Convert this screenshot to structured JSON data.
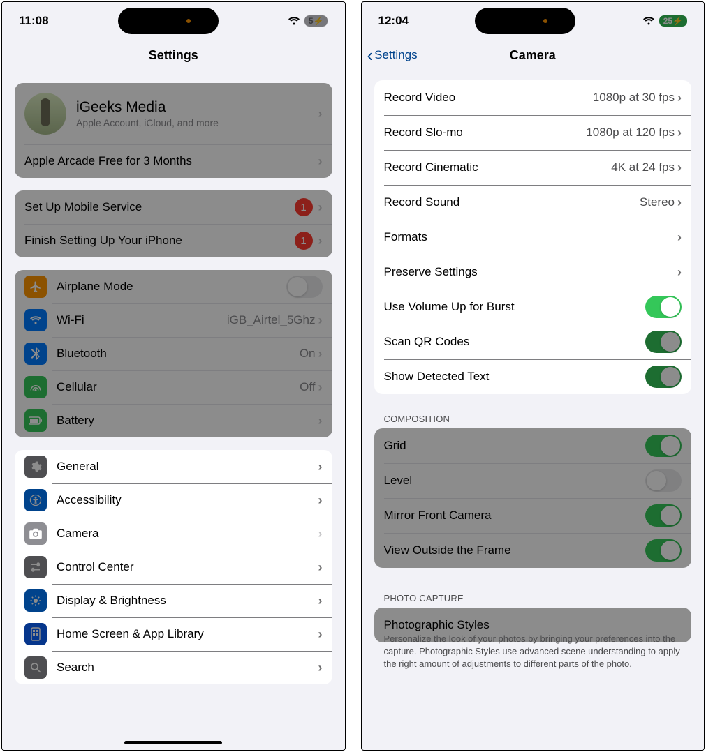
{
  "left": {
    "time": "11:08",
    "battery": "5⚡",
    "title": "Settings",
    "profile": {
      "name": "iGeeks Media",
      "sub": "Apple Account, iCloud, and more"
    },
    "arcade": "Apple Arcade Free for 3 Months",
    "setup": [
      {
        "label": "Set Up Mobile Service",
        "badge": "1"
      },
      {
        "label": "Finish Setting Up Your iPhone",
        "badge": "1"
      }
    ],
    "net": {
      "airplane": "Airplane Mode",
      "wifi": "Wi-Fi",
      "wifi_val": "iGB_Airtel_5Ghz",
      "bt": "Bluetooth",
      "bt_val": "On",
      "cell": "Cellular",
      "cell_val": "Off",
      "batt": "Battery"
    },
    "sys": {
      "general": "General",
      "access": "Accessibility",
      "camera": "Camera",
      "cc": "Control Center",
      "display": "Display & Brightness",
      "home": "Home Screen & App Library",
      "search": "Search"
    }
  },
  "right": {
    "time": "12:04",
    "battery": "25⚡",
    "back": "Settings",
    "title": "Camera",
    "rec": {
      "video_l": "Record Video",
      "video_v": "1080p at 30 fps",
      "slomo_l": "Record Slo-mo",
      "slomo_v": "1080p at 120 fps",
      "cine_l": "Record Cinematic",
      "cine_v": "4K at 24 fps",
      "sound_l": "Record Sound",
      "sound_v": "Stereo",
      "formats": "Formats",
      "preserve": "Preserve Settings",
      "burst": "Use Volume Up for Burst",
      "qr": "Scan QR Codes",
      "detect": "Show Detected Text"
    },
    "comp_h": "Composition",
    "comp": {
      "grid": "Grid",
      "level": "Level",
      "mirror": "Mirror Front Camera",
      "outside": "View Outside the Frame"
    },
    "photo_h": "Photo Capture",
    "photo": {
      "styles": "Photographic Styles",
      "footer": "Personalize the look of your photos by bringing your preferences into the capture. Photographic Styles use advanced scene understanding to apply the right amount of adjustments to different parts of the photo."
    }
  }
}
